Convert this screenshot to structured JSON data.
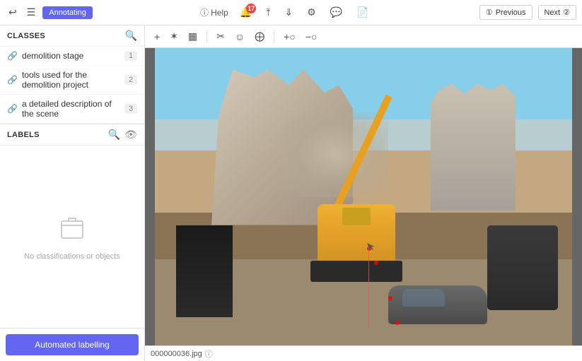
{
  "topbar": {
    "annotating_label": "Annotating",
    "help_label": "Help",
    "notification_count": "17",
    "prev_label": "Previous",
    "next_label": "Next"
  },
  "sidebar": {
    "classes_title": "Classes",
    "classes": [
      {
        "name": "demolition stage",
        "count": "1"
      },
      {
        "name": "tools used for the demolition project",
        "count": "2"
      },
      {
        "name": "a detailed description of the scene",
        "count": "3"
      }
    ],
    "labels_title": "Labels",
    "labels_empty": "No classifications or objects",
    "auto_label_btn": "Automated labelling"
  },
  "toolbar": {
    "tools": [
      "add",
      "star",
      "bbox",
      "cut",
      "emoji",
      "crosshair",
      "zoom-in",
      "zoom-out"
    ]
  },
  "image": {
    "filename": "000000036.jpg"
  }
}
